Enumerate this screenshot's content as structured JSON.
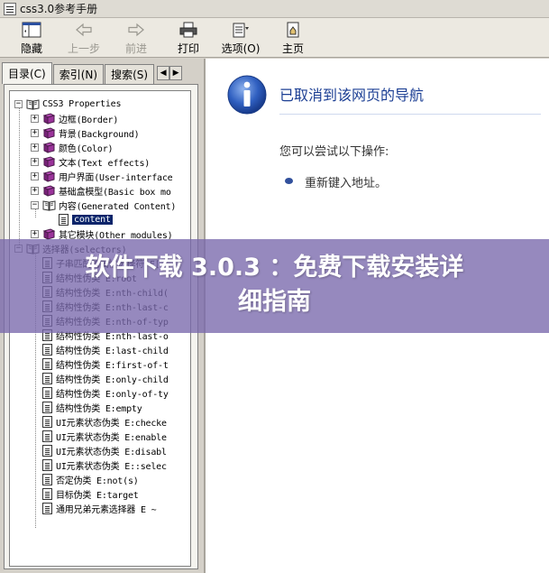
{
  "window": {
    "title": "css3.0参考手册"
  },
  "toolbar": {
    "hide": "隐藏",
    "back": "上一步",
    "forward": "前进",
    "print": "打印",
    "options": "选项(O)",
    "home": "主页"
  },
  "tabs": {
    "contents": "目录(C)",
    "index": "索引(N)",
    "search": "搜索(S)"
  },
  "tree": [
    {
      "label": "CSS3 Properties",
      "expander": "−"
    },
    {
      "label": "边框(Border)",
      "expander": "+"
    },
    {
      "label": "背景(Background)",
      "expander": "+"
    },
    {
      "label": "颜色(Color)",
      "expander": "+"
    },
    {
      "label": "文本(Text effects)",
      "expander": "+"
    },
    {
      "label": "用户界面(User-interface",
      "expander": "+"
    },
    {
      "label": "基础盒模型(Basic box mo",
      "expander": "+"
    },
    {
      "label": "内容(Generated Content)",
      "expander": "−"
    },
    {
      "label": "content"
    },
    {
      "label": "其它模块(Other modules)",
      "expander": "+"
    },
    {
      "label": "选择器(selectors)",
      "expander": "−"
    },
    {
      "label": "子串匹配的属性选择符 E["
    },
    {
      "label": "结构性伪类 E:root"
    },
    {
      "label": "结构性伪类 E:nth-child("
    },
    {
      "label": "结构性伪类 E:nth-last-c"
    },
    {
      "label": "结构性伪类 E:nth-of-typ"
    },
    {
      "label": "结构性伪类 E:nth-last-o"
    },
    {
      "label": "结构性伪类 E:last-child"
    },
    {
      "label": "结构性伪类 E:first-of-t"
    },
    {
      "label": "结构性伪类 E:only-child"
    },
    {
      "label": "结构性伪类 E:only-of-ty"
    },
    {
      "label": "结构性伪类 E:empty"
    },
    {
      "label": "UI元素状态伪类 E:checke"
    },
    {
      "label": "UI元素状态伪类 E:enable"
    },
    {
      "label": "UI元素状态伪类 E:disabl"
    },
    {
      "label": "UI元素状态伪类 E::selec"
    },
    {
      "label": "否定伪类 E:not(s)"
    },
    {
      "label": "目标伪类 E:target"
    },
    {
      "label": "通用兄弟元素选择器 E ~"
    }
  ],
  "content": {
    "heading": "已取消到该网页的导航",
    "subheading": "您可以尝试以下操作:",
    "suggestion": "重新键入地址。"
  },
  "banner": {
    "line1": "软件下载 3.0.3 ：免费下载安装详",
    "line2": "细指南"
  },
  "colors": {
    "selection": "#0a246a",
    "book": "#8a2a8c",
    "info_blue": "#2454b4",
    "banner": "#7868ac"
  }
}
